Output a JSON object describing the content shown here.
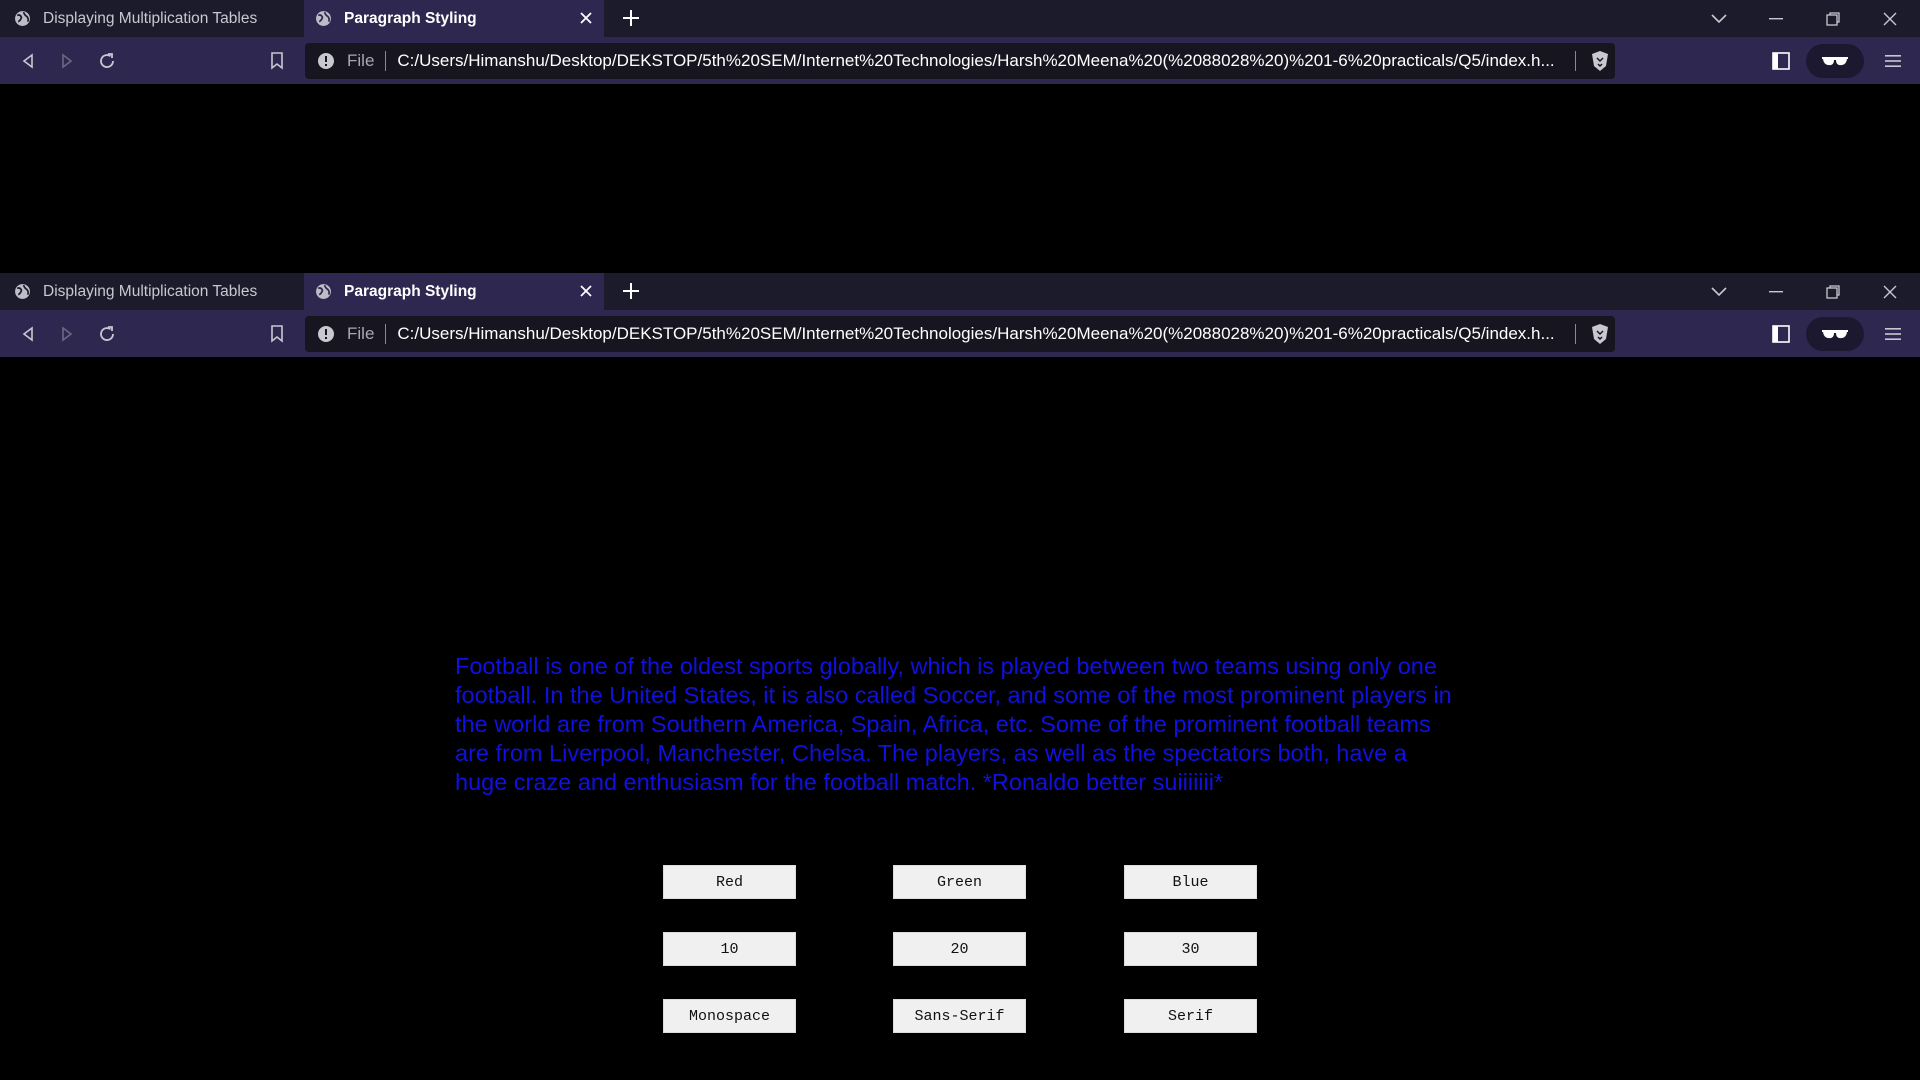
{
  "browser": {
    "tabs": [
      {
        "title": "Displaying Multiplication Tables"
      },
      {
        "title": "Paragraph Styling"
      }
    ],
    "address": {
      "file_label": "File",
      "url": "C:/Users/Himanshu/Desktop/DEKSTOP/5th%20SEM/Internet%20Technologies/Harsh%20Meena%20(%2088028%20)%201-6%20practicals/Q5/index.h..."
    },
    "icons": {
      "back": "back-icon",
      "forward": "forward-icon",
      "reload": "reload-icon",
      "bookmark": "bookmark-icon",
      "info": "info-icon",
      "shield": "brave-shield-icon",
      "sidebar": "sidebar-icon",
      "glasses": "private-glasses-icon",
      "menu": "menu-icon"
    }
  },
  "page": {
    "paragraph": "Football is one of the oldest sports globally, which is played between two teams using only one football. In the United States, it is also called Soccer, and some of the most prominent players in the world are from Southern America, Spain, Africa, etc. Some of the prominent football teams are from Liverpool, Manchester, Chelsa. The players, as well as the spectators both, have a huge craze and enthusiasm for the football match. *Ronaldo better suiiiiiii*",
    "paragraph_color": "#1010e0",
    "color_buttons": [
      "Red",
      "Green",
      "Blue"
    ],
    "size_buttons": [
      "10",
      "20",
      "30"
    ],
    "font_buttons": [
      "Monospace",
      "Sans-Serif",
      "Serif"
    ]
  },
  "theme": {
    "tabbar_bg": "#1c1b2b",
    "toolbar_bg": "#2e2750",
    "page_bg": "#000000"
  }
}
